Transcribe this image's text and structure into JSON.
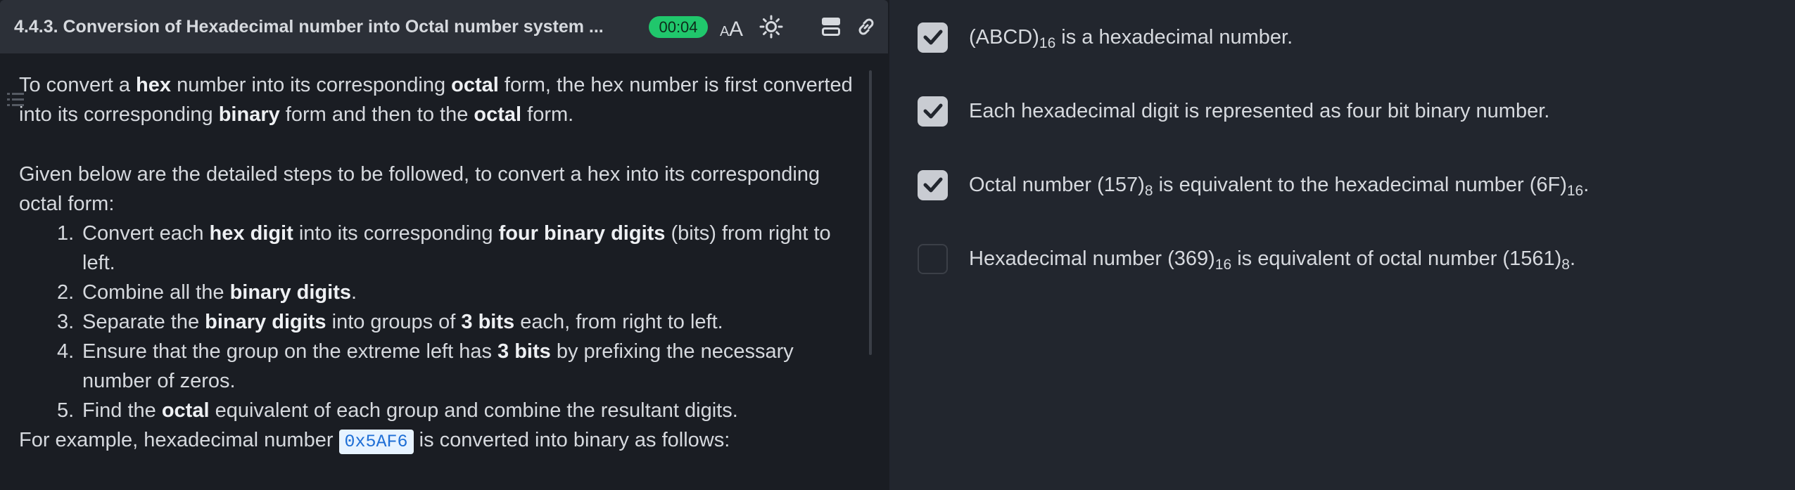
{
  "header": {
    "title": "4.4.3. Conversion of Hexadecimal number into Octal number system ...",
    "timer": "00:04",
    "icons": [
      "font-size-icon",
      "theme-toggle-icon",
      "layout-icon",
      "link-icon"
    ]
  },
  "content": {
    "para1": {
      "t1": "To convert a ",
      "b1": "hex",
      "t2": " number into its corresponding ",
      "b2": "octal",
      "t3": " form, the hex number is first converted into its corresponding ",
      "b3": "binary",
      "t4": " form and then to the ",
      "b4": "octal",
      "t5": " form."
    },
    "para2": "Given below are the detailed steps to be followed, to convert a hex into its corresponding octal form:",
    "steps": [
      {
        "num": "1.",
        "t1": "Convert each ",
        "b1": "hex digit",
        "t2": " into its corresponding ",
        "b2": "four binary digits",
        "t3": " (bits) from right to left."
      },
      {
        "num": "2.",
        "t1": "Combine all the ",
        "b1": "binary digits",
        "t2": "."
      },
      {
        "num": "3.",
        "t1": "Separate the ",
        "b1": "binary digits",
        "t2": " into groups of ",
        "b2": "3 bits",
        "t3": " each, from right to left."
      },
      {
        "num": "4.",
        "t1": "Ensure that the group on the extreme left has ",
        "b1": "3 bits",
        "t2": " by prefixing the necessary number of zeros."
      },
      {
        "num": "5.",
        "t1": "Find the ",
        "b1": "octal",
        "t2": " equivalent of each group and combine the resultant digits."
      }
    ],
    "example": {
      "t1": "For example, hexadecimal number ",
      "code": "0x5AF6",
      "t2": " is converted into binary as follows:"
    }
  },
  "options": [
    {
      "checked": true,
      "a": "(ABCD)",
      "a_sub": "16",
      "b": " is a hexadecimal number.",
      "b_sub": "",
      "c": ""
    },
    {
      "checked": true,
      "a": "Each hexadecimal digit is represented as four bit binary number.",
      "a_sub": "",
      "b": "",
      "b_sub": "",
      "c": ""
    },
    {
      "checked": true,
      "a": "Octal number (157)",
      "a_sub": "8",
      "b": " is equivalent to the hexadecimal number (6F)",
      "b_sub": "16",
      "c": "."
    },
    {
      "checked": false,
      "a": "Hexadecimal number (369)",
      "a_sub": "16",
      "b": " is equivalent of octal number (1561)",
      "b_sub": "8",
      "c": "."
    }
  ],
  "colors": {
    "timer": "#20c76c",
    "code_bg": "#e7f3ff",
    "code_text": "#1f6fd6",
    "checkbox_checked": "#c9ccd2"
  }
}
